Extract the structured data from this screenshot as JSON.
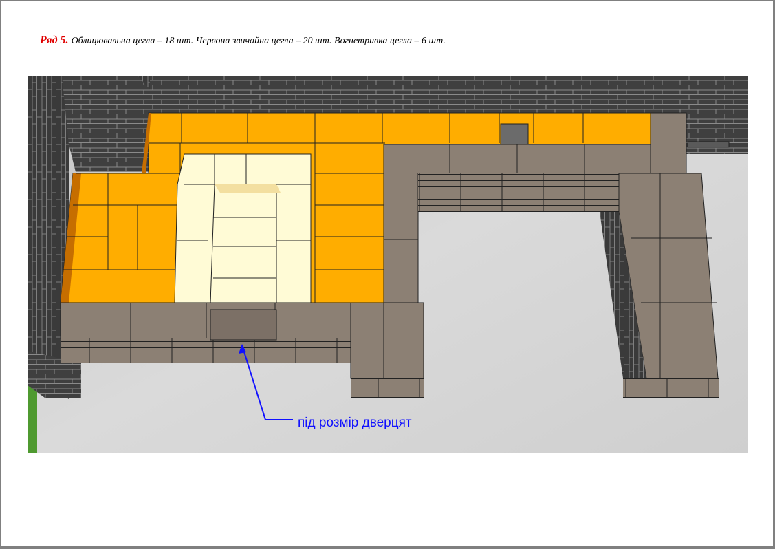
{
  "caption": {
    "row_label": "Ряд 5.",
    "text": "Облицювальна цегла – 18 шт. Червона звичайна цегла – 20 шт. Вогнетривка цегла – 6 шт."
  },
  "annotation": {
    "label": "під розмір дверцят"
  },
  "colors": {
    "facing_brick": "#8c8074",
    "red_brick": "#ffad00",
    "firebrick": "#fffbd6",
    "wall": "#3c3c3c",
    "floor": "#d0d0d0",
    "arrow": "#1010ff",
    "row_label": "#e00000"
  }
}
